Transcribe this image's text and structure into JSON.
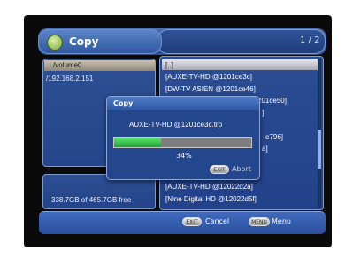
{
  "header": {
    "title": "Copy",
    "page_indicator": "1 / 2"
  },
  "left_panel": {
    "items": [
      {
        "label": "/volume0",
        "selected": true
      },
      {
        "label": "/192.168.2.151",
        "selected": false
      }
    ],
    "free_space": "338.7GB of 465.7GB free"
  },
  "right_panel": {
    "items": [
      {
        "label": "[..]",
        "selected": true
      },
      {
        "label": "[AUXE-TV-HD @1201ce3c]"
      },
      {
        "label": "[DW-TV ASIEN @1201ce46]"
      },
      {
        "label": "...HD @1201ce50]"
      },
      {
        "label": "]"
      },
      {
        "label": "e796]"
      },
      {
        "label": "a]"
      },
      {
        "label": "[AUXE-TV-HD @12022d2a]"
      },
      {
        "label": "[Nine Digital HD @12022d5f]"
      }
    ]
  },
  "dialog": {
    "title": "Copy",
    "filename": "AUXE-TV-HD @1201ce3c.trp",
    "progress_percent": 34,
    "progress_label": "34%",
    "exit_button": "EXIT",
    "abort_label": "Abort"
  },
  "footer": {
    "exit_button": "EXIT",
    "cancel_label": "Cancel",
    "menu_button": "MENU",
    "menu_label": "Menu"
  },
  "colors": {
    "background": "#0a0a0a",
    "panel": "#2b4d92",
    "progress": "#2bbf3f"
  }
}
